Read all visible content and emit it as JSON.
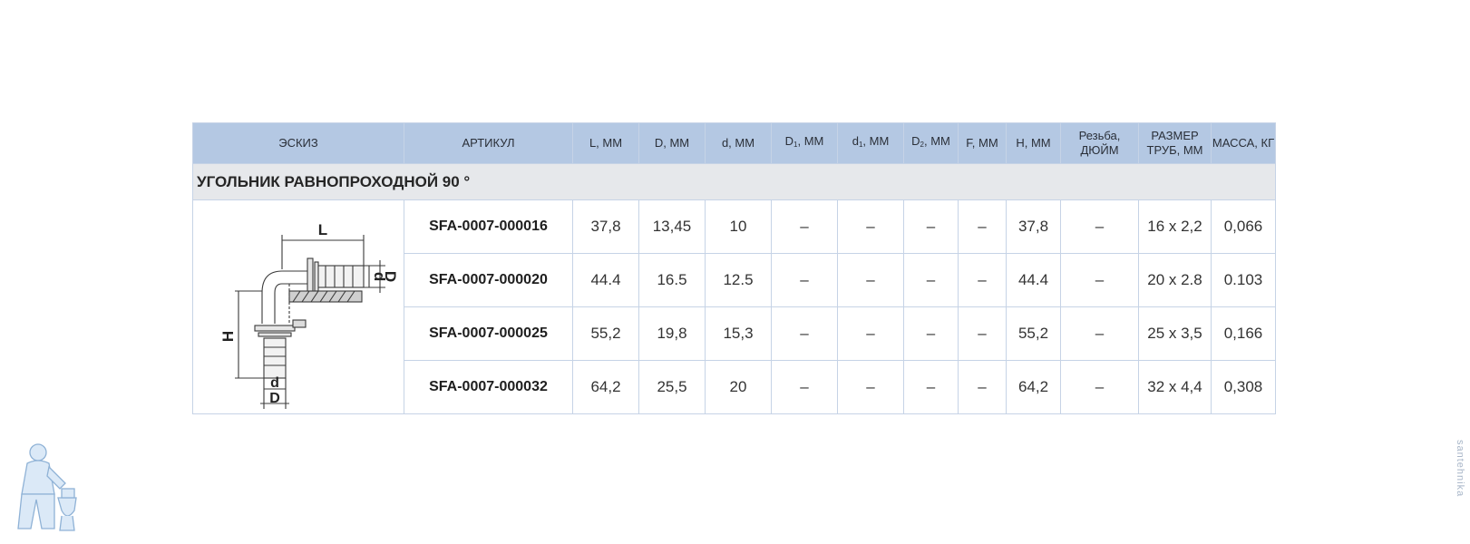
{
  "table": {
    "headers": {
      "sketch": "ЭСКИЗ",
      "article": "АРТИКУЛ",
      "L": "L, ММ",
      "D": "D, ММ",
      "d": "d, ММ",
      "D1_base": "D",
      "D1_sub": "1",
      "D1_unit": ", ММ",
      "d1_base": "d",
      "d1_sub": "1",
      "d1_unit": ", ММ",
      "D2_base": "D",
      "D2_sub": "2",
      "D2_unit": ", ММ",
      "F": "F, ММ",
      "H": "H, ММ",
      "thread_line1": "Резьба,",
      "thread_line2": "ДЮЙМ",
      "pipe_line1": "РАЗМЕР",
      "pipe_line2": "ТРУБ, ММ",
      "mass": "МАССА, КГ"
    },
    "section_title": "УГОЛЬНИК РАВНОПРОХОДНОЙ 90 °",
    "rows": [
      {
        "article": "SFA-0007-000016",
        "L": "37,8",
        "D": "13,45",
        "d": "10",
        "D1": "–",
        "d1": "–",
        "D2": "–",
        "F": "–",
        "H": "37,8",
        "thread": "–",
        "pipe": "16 x 2,2",
        "mass": "0,066"
      },
      {
        "article": "SFA-0007-000020",
        "L": "44.4",
        "D": "16.5",
        "d": "12.5",
        "D1": "–",
        "d1": "–",
        "D2": "–",
        "F": "–",
        "H": "44.4",
        "thread": "–",
        "pipe": "20 x 2.8",
        "mass": "0.103"
      },
      {
        "article": "SFA-0007-000025",
        "L": "55,2",
        "D": "19,8",
        "d": "15,3",
        "D1": "–",
        "d1": "–",
        "D2": "–",
        "F": "–",
        "H": "55,2",
        "thread": "–",
        "pipe": "25 x 3,5",
        "mass": "0,166"
      },
      {
        "article": "SFA-0007-000032",
        "L": "64,2",
        "D": "25,5",
        "d": "20",
        "D1": "–",
        "d1": "–",
        "D2": "–",
        "F": "–",
        "H": "64,2",
        "thread": "–",
        "pipe": "32 x 4,4",
        "mass": "0,308"
      }
    ]
  },
  "sketch_labels": {
    "L": "L",
    "H": "H",
    "d_right": "d",
    "D_right": "D",
    "d_bottom": "d",
    "D_bottom": "D"
  },
  "side_mark": "santehnika"
}
